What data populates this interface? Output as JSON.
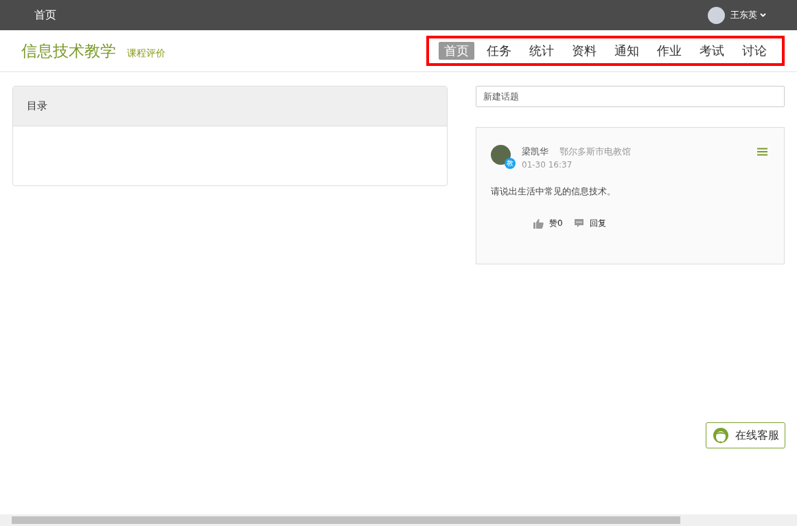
{
  "top_bar": {
    "home_link": "首页",
    "user_name": "王东英"
  },
  "course_header": {
    "title": "信息技术教学",
    "subtitle_link": "课程评价"
  },
  "tabs": [
    {
      "label": "首页",
      "selected": true
    },
    {
      "label": "任务",
      "selected": false
    },
    {
      "label": "统计",
      "selected": false
    },
    {
      "label": "资料",
      "selected": false
    },
    {
      "label": "通知",
      "selected": false
    },
    {
      "label": "作业",
      "selected": false
    },
    {
      "label": "考试",
      "selected": false
    },
    {
      "label": "讨论",
      "selected": false
    }
  ],
  "catalog": {
    "title": "目录"
  },
  "new_topic": {
    "placeholder": "新建话题"
  },
  "posts": [
    {
      "author": "梁凯华",
      "org": "鄂尔多斯市电教馆",
      "badge": "教",
      "time": "01-30 16:37",
      "content": "请说出生活中常见的信息技术。",
      "like_label": "赞0",
      "reply_label": "回复"
    }
  ],
  "support_button": "在线客服"
}
